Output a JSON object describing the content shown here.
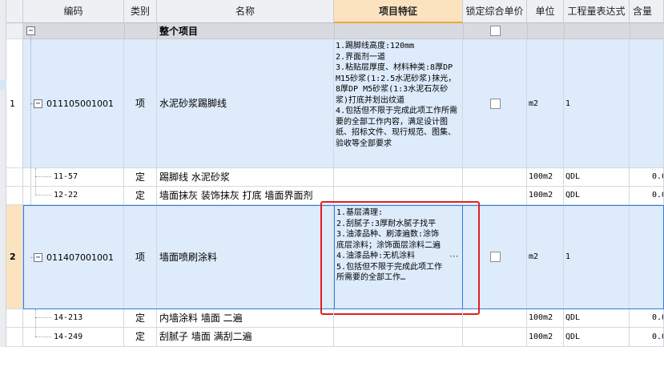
{
  "columns": {
    "code": "编码",
    "category": "类别",
    "name": "名称",
    "features": "项目特征",
    "lock_price": "锁定综合单价",
    "unit": "单位",
    "expr": "工程量表达式",
    "contain": "含量"
  },
  "group_row": {
    "name": "整个项目",
    "toggle": "−"
  },
  "rows": [
    {
      "index": "1",
      "toggle": "−",
      "code": "011105001001",
      "category": "项",
      "name": "水泥砂浆踢脚线",
      "features": "1.踢脚线高度:120mm\n2.界面剂一道\n3.粘贴层厚度、材料种类:8厚DP M15砂浆(1:2.5水泥砂浆)抹光，8厚DP M5砂浆(1:3水泥石灰砂浆)打底并划出纹道\n4.包括但不限于完成此项工作所需要的全部工作内容，满足设计图纸、招标文件、现行规范、图集、验收等全部要求",
      "unit": "m2",
      "expr": "1"
    },
    {
      "code": "11-57",
      "category": "定",
      "name": "踢脚线 水泥砂浆",
      "unit": "100m2",
      "expr": "QDL",
      "contain": "0.0"
    },
    {
      "code": "12-22",
      "category": "定",
      "name": "墙面抹灰 装饰抹灰 打底 墙面界面剂",
      "unit": "100m2",
      "expr": "QDL",
      "contain": "0.0"
    },
    {
      "index": "2",
      "toggle": "−",
      "code": "011407001001",
      "category": "项",
      "name": "墙面喷刷涂料",
      "features": "1.基层清理:\n2.刮腻子:3厚耐水腻子找平\n3.油漆品种、刷漆遍数:涂饰底层涂料；涂饰面层涂料二遍\n4.油漆品种:无机涂料\n5.包括但不限于完成此项工作所需要的全部工作…",
      "ellipsis": "···",
      "unit": "m2",
      "expr": "1"
    },
    {
      "code": "14-213",
      "category": "定",
      "name": "内墙涂料 墙面 二遍",
      "unit": "100m2",
      "expr": "QDL",
      "contain": "0.0"
    },
    {
      "code": "14-249",
      "category": "定",
      "name": "刮腻子 墙面 满刮二遍",
      "unit": "100m2",
      "expr": "QDL",
      "contain": "0.0"
    }
  ],
  "colors": {
    "header_bg": "#eef0f4",
    "header_active_bg": "#fbe3bf",
    "group_bg": "#d8dadf",
    "item_bg": "#ddebfb",
    "selected_border": "#2d7fe0",
    "highlight_box": "#e02020",
    "row_marker": "#fbe3bf"
  }
}
